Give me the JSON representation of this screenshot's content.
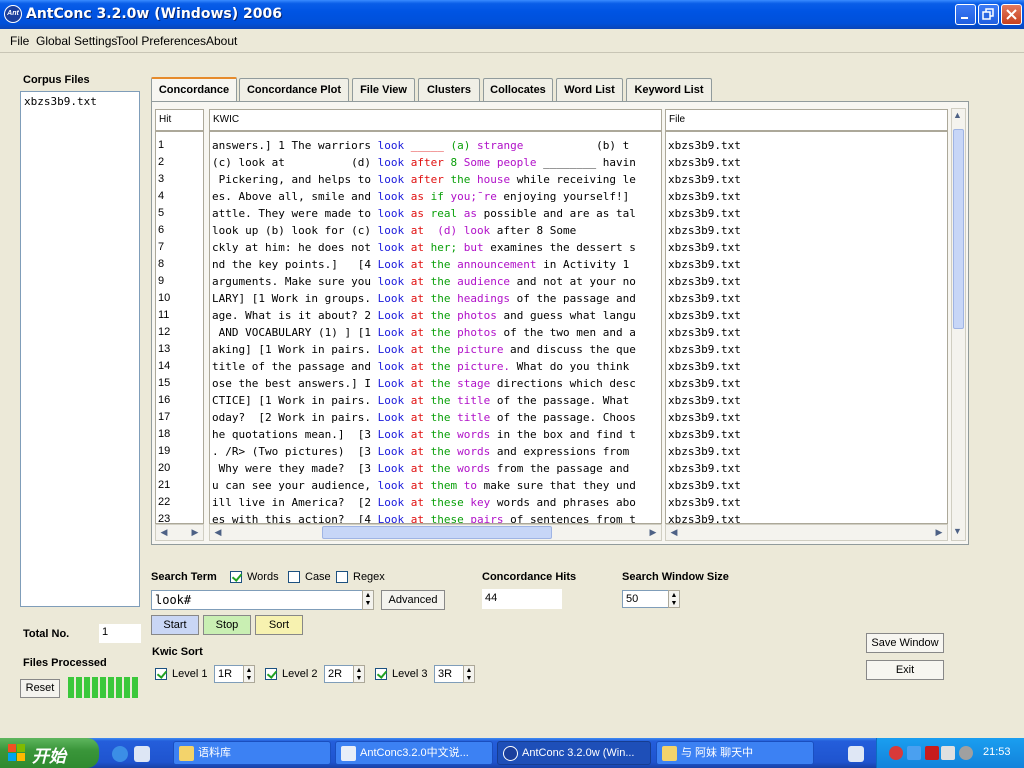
{
  "window": {
    "title": "AntConc 3.2.0w (Windows) 2006",
    "app_icon_text": "Ant"
  },
  "menu": [
    "File",
    "Global Settings",
    "Tool Preferences",
    "About"
  ],
  "left_panel": {
    "corpus_files_label": "Corpus Files",
    "corpus_files": [
      "xbzs3b9.txt"
    ],
    "total_no_label": "Total No.",
    "total_no_value": "1",
    "files_processed_label": "Files Processed",
    "reset_label": "Reset",
    "progress_fraction": 1.0
  },
  "tabs": [
    {
      "label": "Concordance",
      "active": true
    },
    {
      "label": "Concordance Plot",
      "active": false
    },
    {
      "label": "File View",
      "active": false
    },
    {
      "label": "Clusters",
      "active": false
    },
    {
      "label": "Collocates",
      "active": false
    },
    {
      "label": "Word List",
      "active": false
    },
    {
      "label": "Keyword List",
      "active": false
    }
  ],
  "results": {
    "columns": {
      "hit": "Hit",
      "kwic": "KWIC",
      "file": "File"
    },
    "rows": [
      {
        "hit": "1",
        "left": "answers.] 1 The warriors ",
        "kw": "look",
        "r1": "_____",
        "r2": "(a)",
        "r3": "strange",
        "rest": "           (b) t",
        "file": "xbzs3b9.txt"
      },
      {
        "hit": "2",
        "left": "(c) look at          (d) ",
        "kw": "look",
        "r1": "after",
        "r2": "8",
        "r3": "Some people",
        "rest": " ________ havin",
        "file": "xbzs3b9.txt"
      },
      {
        "hit": "3",
        "left": " Pickering, and helps to ",
        "kw": "look",
        "r1": "after",
        "r2": "the",
        "r3": "house",
        "rest": " while receiving le",
        "file": "xbzs3b9.txt"
      },
      {
        "hit": "4",
        "left": "es. Above all, smile and ",
        "kw": "look",
        "r1": "as",
        "r2": "if",
        "r3": "you;¯re",
        "rest": " enjoying yourself!]",
        "file": "xbzs3b9.txt"
      },
      {
        "hit": "5",
        "left": "attle. They were made to ",
        "kw": "look",
        "r1": "as",
        "r2": "real",
        "r3": "as",
        "rest": " possible and are as tal",
        "file": "xbzs3b9.txt"
      },
      {
        "hit": "6",
        "left": "look up (b) look for (c) ",
        "kw": "look",
        "r1": "at",
        "r2": "",
        "r3": "(d) look",
        "rest": " after 8 Some",
        "file": "xbzs3b9.txt"
      },
      {
        "hit": "7",
        "left": "ckly at him: he does not ",
        "kw": "look",
        "r1": "at",
        "r2": "her;",
        "r3": "but",
        "rest": " examines the dessert s",
        "file": "xbzs3b9.txt"
      },
      {
        "hit": "8",
        "left": "nd the key points.]   [4 ",
        "kw": "Look",
        "r1": "at",
        "r2": "the",
        "r3": "announcement",
        "rest": " in Activity 1",
        "file": "xbzs3b9.txt"
      },
      {
        "hit": "9",
        "left": "arguments. Make sure you ",
        "kw": "look",
        "r1": "at",
        "r2": "the",
        "r3": "audience",
        "rest": " and not at your no",
        "file": "xbzs3b9.txt"
      },
      {
        "hit": "10",
        "left": "LARY] [1 Work in groups. ",
        "kw": "Look",
        "r1": "at",
        "r2": "the",
        "r3": "headings",
        "rest": " of the passage and",
        "file": "xbzs3b9.txt"
      },
      {
        "hit": "11",
        "left": "age. What is it about? 2 ",
        "kw": "Look",
        "r1": "at",
        "r2": "the",
        "r3": "photos",
        "rest": " and guess what langu",
        "file": "xbzs3b9.txt"
      },
      {
        "hit": "12",
        "left": " AND VOCABULARY (1) ] [1 ",
        "kw": "Look",
        "r1": "at",
        "r2": "the",
        "r3": "photos",
        "rest": " of the two men and a",
        "file": "xbzs3b9.txt"
      },
      {
        "hit": "13",
        "left": "aking] [1 Work in pairs. ",
        "kw": "Look",
        "r1": "at",
        "r2": "the",
        "r3": "picture",
        "rest": " and discuss the que",
        "file": "xbzs3b9.txt"
      },
      {
        "hit": "14",
        "left": "title of the passage and ",
        "kw": "look",
        "r1": "at",
        "r2": "the",
        "r3": "picture.",
        "rest": " What do you think",
        "file": "xbzs3b9.txt"
      },
      {
        "hit": "15",
        "left": "ose the best answers.] I ",
        "kw": "Look",
        "r1": "at",
        "r2": "the",
        "r3": "stage",
        "rest": " directions which desc",
        "file": "xbzs3b9.txt"
      },
      {
        "hit": "16",
        "left": "CTICE] [1 Work in pairs. ",
        "kw": "Look",
        "r1": "at",
        "r2": "the",
        "r3": "title",
        "rest": " of the passage. What",
        "file": "xbzs3b9.txt"
      },
      {
        "hit": "17",
        "left": "oday?  [2 Work in pairs. ",
        "kw": "Look",
        "r1": "at",
        "r2": "the",
        "r3": "title",
        "rest": " of the passage. Choos",
        "file": "xbzs3b9.txt"
      },
      {
        "hit": "18",
        "left": "he quotations mean.]  [3 ",
        "kw": "Look",
        "r1": "at",
        "r2": "the",
        "r3": "words",
        "rest": " in the box and find t",
        "file": "xbzs3b9.txt"
      },
      {
        "hit": "19",
        "left": ". /R> (Two pictures)  [3 ",
        "kw": "Look",
        "r1": "at",
        "r2": "the",
        "r3": "words",
        "rest": " and expressions from",
        "file": "xbzs3b9.txt"
      },
      {
        "hit": "20",
        "left": " Why were they made?  [3 ",
        "kw": "Look",
        "r1": "at",
        "r2": "the",
        "r3": "words",
        "rest": " from the passage and",
        "file": "xbzs3b9.txt"
      },
      {
        "hit": "21",
        "left": "u can see your audience, ",
        "kw": "look",
        "r1": "at",
        "r2": "them",
        "r3": "to",
        "rest": " make sure that they und",
        "file": "xbzs3b9.txt"
      },
      {
        "hit": "22",
        "left": "ill live in America?  [2 ",
        "kw": "Look",
        "r1": "at",
        "r2": "these",
        "r3": "key",
        "rest": " words and phrases abo",
        "file": "xbzs3b9.txt"
      },
      {
        "hit": "23",
        "left": "es with this action?  [4 ",
        "kw": "Look",
        "r1": "at",
        "r2": "these",
        "r3": "pairs",
        "rest": " of sentences from t",
        "file": "xbzs3b9.txt"
      }
    ]
  },
  "search": {
    "search_term_label": "Search Term",
    "words_label": "Words",
    "words_checked": true,
    "case_label": "Case",
    "case_checked": false,
    "regex_label": "Regex",
    "regex_checked": false,
    "term_value": "look#",
    "advanced_label": "Advanced",
    "start_label": "Start",
    "stop_label": "Stop",
    "sort_label": "Sort",
    "hits_label": "Concordance Hits",
    "hits_value": "44",
    "window_size_label": "Search Window Size",
    "window_size_value": "50"
  },
  "kwic_sort": {
    "label": "Kwic Sort",
    "levels": [
      {
        "label": "Level 1",
        "value": "1R",
        "checked": true
      },
      {
        "label": "Level 2",
        "value": "2R",
        "checked": true
      },
      {
        "label": "Level 3",
        "value": "3R",
        "checked": true
      }
    ]
  },
  "actions": {
    "save_window_label": "Save Window",
    "exit_label": "Exit"
  },
  "taskbar": {
    "start_label": "开始",
    "tasks": [
      {
        "label": "语料库",
        "active": false
      },
      {
        "label": "AntConc3.2.0中文说...",
        "active": false
      },
      {
        "label": "AntConc 3.2.0w (Win...",
        "active": true
      },
      {
        "label": "与 阿妹 聊天中",
        "active": false
      }
    ],
    "clock": "21:53"
  },
  "colors": {
    "keyword": "#1a1adc",
    "r1": "#e01010",
    "r2": "#0aa00a",
    "r3": "#b010c8",
    "accent": "#0054e3"
  }
}
